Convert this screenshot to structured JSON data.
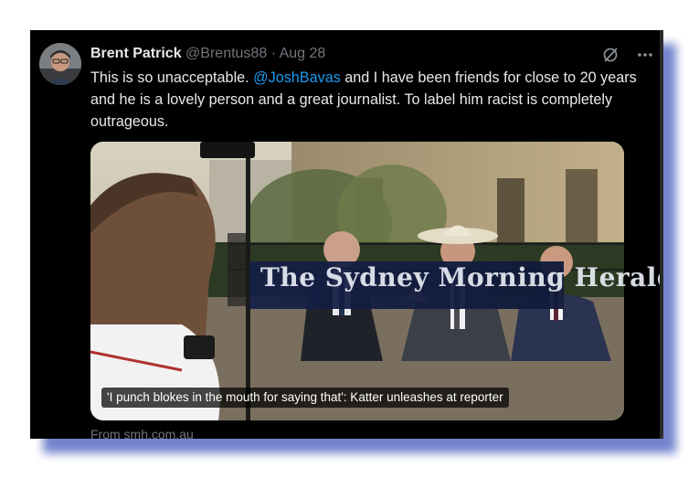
{
  "tweet": {
    "author_name": "Brent Patrick",
    "handle": "@Brentus88",
    "separator": "·",
    "date": "Aug 28",
    "text_before": "This is so unacceptable. ",
    "mention": "@JoshBavas",
    "text_after": " and I have been friends for close to 20 years and he is a lovely person and a great journalist. To label him racist is completely outrageous."
  },
  "media": {
    "caption": "'I punch blokes in the mouth for saying that': Katter unleashes at reporter",
    "watermark": "The Sydney Morning Herald",
    "source": "From smh.com.au"
  },
  "icons": {
    "grok": "grok-icon",
    "more": "more-icon"
  },
  "colors": {
    "background": "#000000",
    "text": "#e7e9ea",
    "muted": "#71767b",
    "link": "#1d9bf0",
    "shadow": "#5a6fc4"
  }
}
